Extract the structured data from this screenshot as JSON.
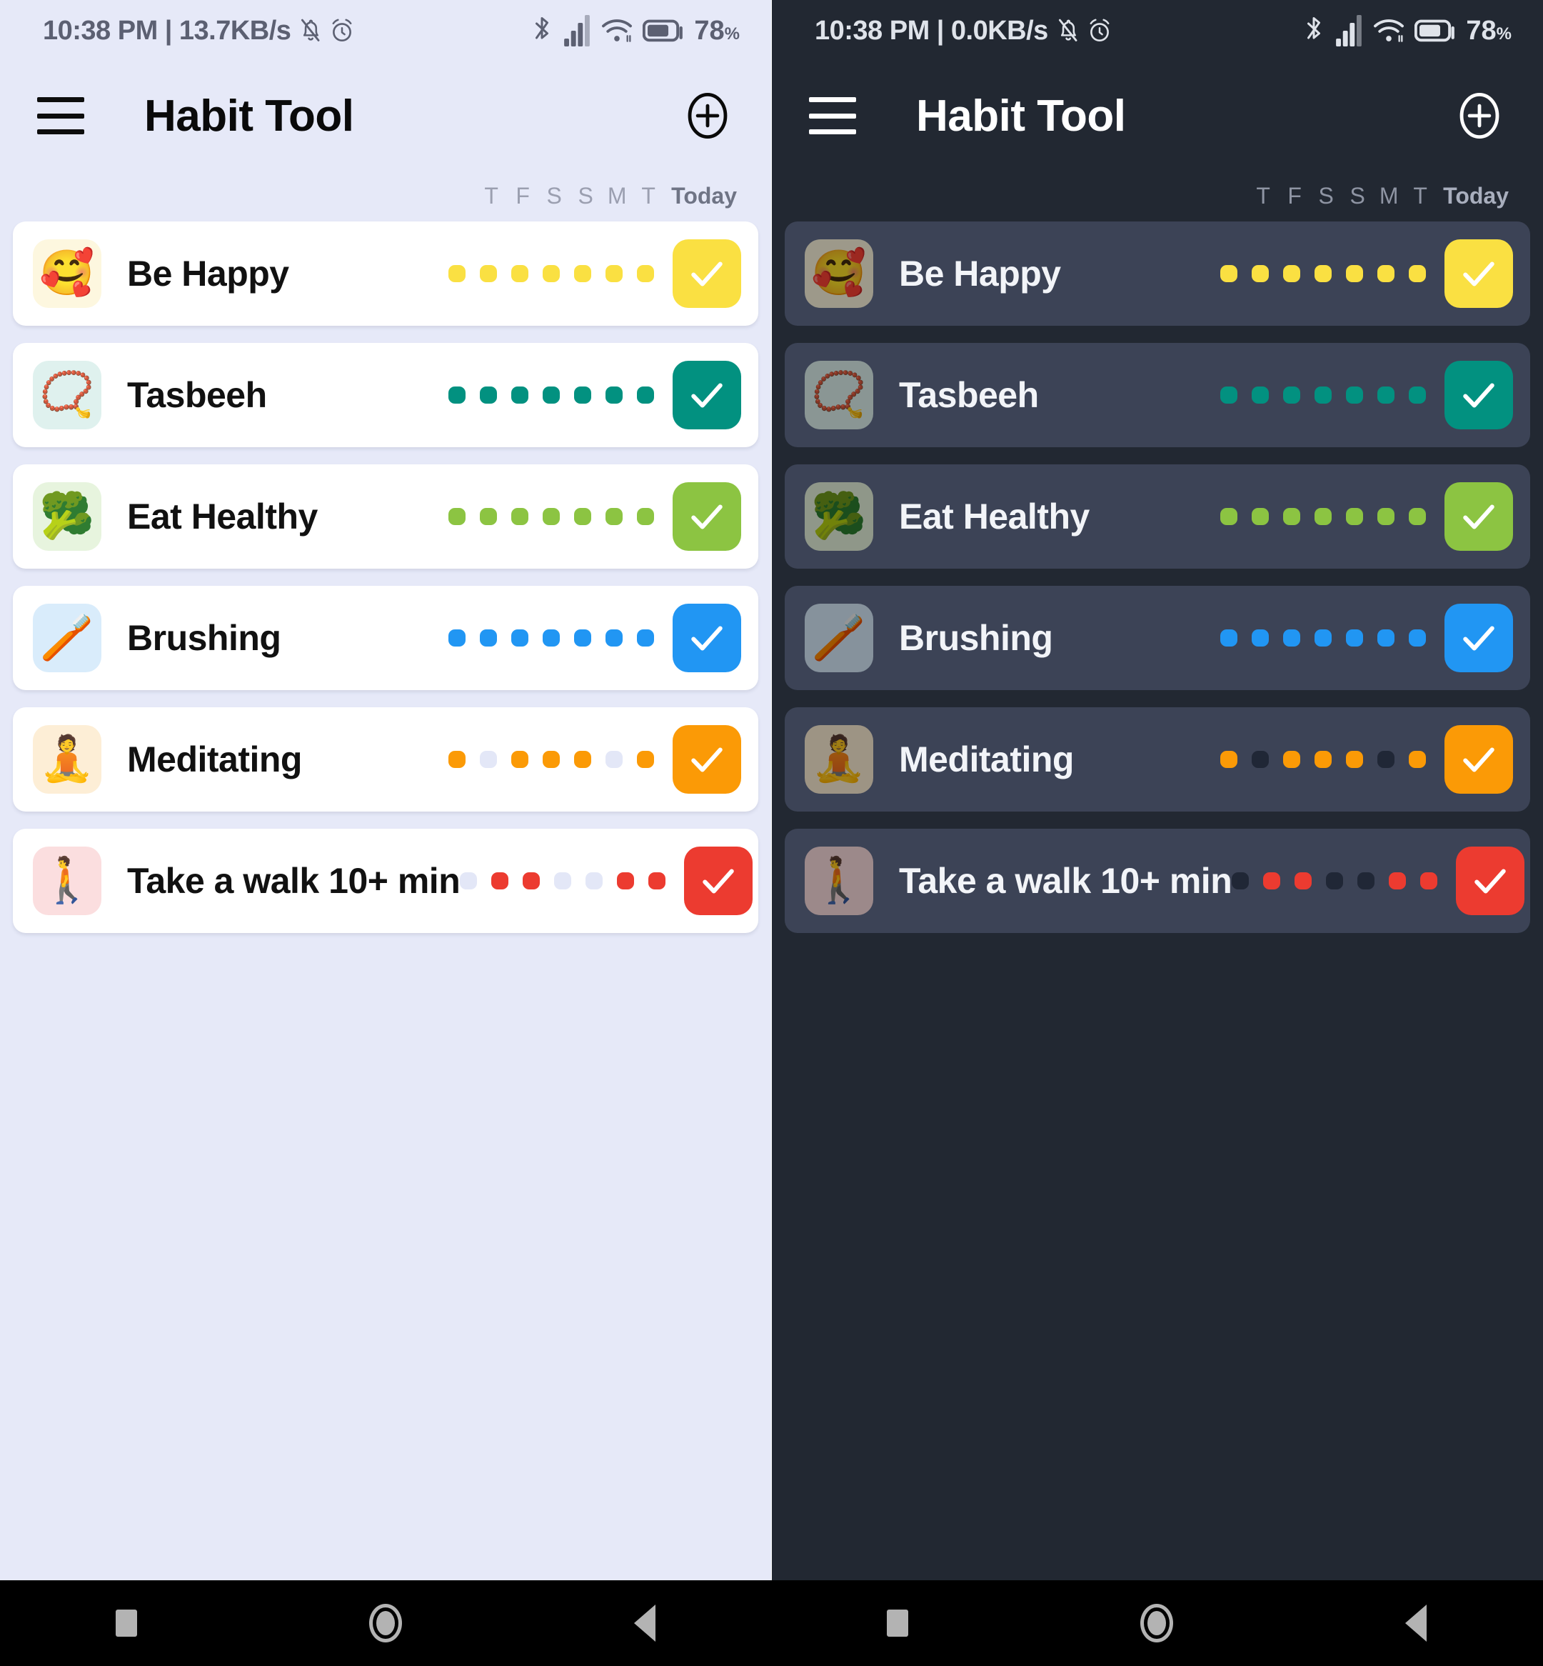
{
  "nav_bar": {
    "recents_label": "recents-square",
    "home_label": "home-circle",
    "back_label": "back-triangle"
  },
  "panels": [
    {
      "theme": "light",
      "status_bar": {
        "time": "10:38 PM",
        "separator": "|",
        "net_speed": "13.7KB/s",
        "mute_icon": "bell-muted-icon",
        "alarm_icon": "alarm-clock-icon",
        "bluetooth_icon": "bluetooth-icon",
        "signal_icon": "cellular-signal-icon",
        "wifi_icon": "wifi-icon",
        "battery_icon": "battery-icon",
        "battery_percent": "78",
        "percent_sign": "%"
      },
      "app_bar": {
        "menu_icon": "hamburger-menu-icon",
        "title": "Habit Tool",
        "add_icon": "add-circle-icon"
      },
      "day_header": {
        "days": [
          "T",
          "F",
          "S",
          "S",
          "M",
          "T"
        ],
        "today_label": "Today"
      },
      "habits": [
        {
          "name": "Be Happy",
          "emoji": "🥰",
          "icon_name": "smiling-face-with-hearts-icon",
          "icon_bg": "#fdf7df",
          "color": "#fae042",
          "check_icon": "checkmark-icon",
          "week": [
            1,
            1,
            1,
            1,
            1,
            1,
            1
          ]
        },
        {
          "name": "Tasbeeh",
          "emoji": "📿",
          "icon_name": "prayer-beads-icon",
          "icon_bg": "#dff1ee",
          "color": "#029180",
          "check_icon": "checkmark-icon",
          "week": [
            1,
            1,
            1,
            1,
            1,
            1,
            1
          ]
        },
        {
          "name": "Eat Healthy",
          "emoji": "🥦",
          "icon_name": "broccoli-icon",
          "icon_bg": "#e7f4de",
          "color": "#8cc442",
          "check_icon": "checkmark-icon",
          "week": [
            1,
            1,
            1,
            1,
            1,
            1,
            1
          ]
        },
        {
          "name": "Brushing",
          "emoji": "🪥",
          "icon_name": "toothbrush-icon",
          "icon_bg": "#d9ecfb",
          "color": "#2196f3",
          "check_icon": "checkmark-icon",
          "week": [
            1,
            1,
            1,
            1,
            1,
            1,
            1
          ]
        },
        {
          "name": "Meditating",
          "emoji": "🧘",
          "icon_name": "person-lotus-position-icon",
          "icon_bg": "#fdeed6",
          "color": "#fb9a06",
          "check_icon": "checkmark-icon",
          "week": [
            1,
            0,
            1,
            1,
            1,
            0,
            1
          ]
        },
        {
          "name": "Take a walk 10+ min",
          "emoji": "🚶",
          "icon_name": "person-walking-icon",
          "icon_bg": "#fbdedf",
          "color": "#ec3b30",
          "check_icon": "checkmark-icon",
          "week": [
            0,
            1,
            1,
            0,
            0,
            1,
            1
          ]
        }
      ]
    },
    {
      "theme": "dark",
      "status_bar": {
        "time": "10:38 PM",
        "separator": "|",
        "net_speed": "0.0KB/s",
        "mute_icon": "bell-muted-icon",
        "alarm_icon": "alarm-clock-icon",
        "bluetooth_icon": "bluetooth-icon",
        "signal_icon": "cellular-signal-icon",
        "wifi_icon": "wifi-icon",
        "battery_icon": "battery-icon",
        "battery_percent": "78",
        "percent_sign": "%"
      },
      "app_bar": {
        "menu_icon": "hamburger-menu-icon",
        "title": "Habit Tool",
        "add_icon": "add-circle-icon"
      },
      "day_header": {
        "days": [
          "T",
          "F",
          "S",
          "S",
          "M",
          "T"
        ],
        "today_label": "Today"
      },
      "habits": [
        {
          "name": "Be Happy",
          "emoji": "🥰",
          "icon_name": "smiling-face-with-hearts-icon",
          "icon_bg": "#fdf7df",
          "color": "#fae042",
          "check_icon": "checkmark-icon",
          "week": [
            1,
            1,
            1,
            1,
            1,
            1,
            1
          ]
        },
        {
          "name": "Tasbeeh",
          "emoji": "📿",
          "icon_name": "prayer-beads-icon",
          "icon_bg": "#dff1ee",
          "color": "#029180",
          "check_icon": "checkmark-icon",
          "week": [
            1,
            1,
            1,
            1,
            1,
            1,
            1
          ]
        },
        {
          "name": "Eat Healthy",
          "emoji": "🥦",
          "icon_name": "broccoli-icon",
          "icon_bg": "#e7f4de",
          "color": "#8cc442",
          "check_icon": "checkmark-icon",
          "week": [
            1,
            1,
            1,
            1,
            1,
            1,
            1
          ]
        },
        {
          "name": "Brushing",
          "emoji": "🪥",
          "icon_name": "toothbrush-icon",
          "icon_bg": "#d9ecfb",
          "color": "#2196f3",
          "check_icon": "checkmark-icon",
          "week": [
            1,
            1,
            1,
            1,
            1,
            1,
            1
          ]
        },
        {
          "name": "Meditating",
          "emoji": "🧘",
          "icon_name": "person-lotus-position-icon",
          "icon_bg": "#fdeed6",
          "color": "#fb9a06",
          "check_icon": "checkmark-icon",
          "week": [
            1,
            0,
            1,
            1,
            1,
            0,
            1
          ]
        },
        {
          "name": "Take a walk 10+ min",
          "emoji": "🚶",
          "icon_name": "person-walking-icon",
          "icon_bg": "#fbdedf",
          "color": "#ec3b30",
          "check_icon": "checkmark-icon",
          "week": [
            0,
            1,
            1,
            0,
            0,
            1,
            1
          ]
        }
      ]
    }
  ]
}
